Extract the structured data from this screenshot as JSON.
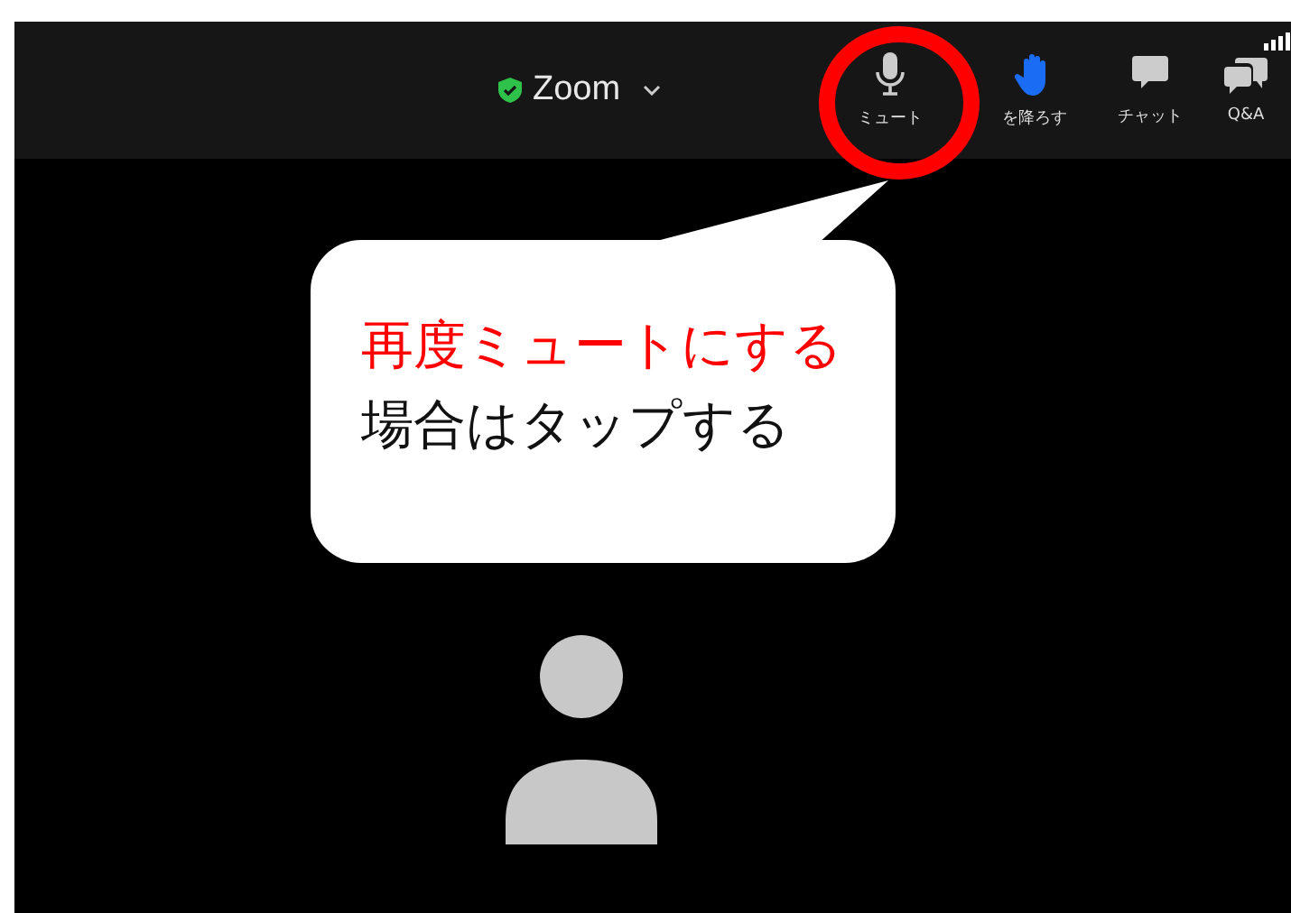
{
  "meeting_bar": {
    "title": "Zoom",
    "buttons": [
      {
        "kind": "mic",
        "label": "ミュート"
      },
      {
        "kind": "hand",
        "label": "を降ろす"
      },
      {
        "kind": "chat",
        "label": "チャット"
      },
      {
        "kind": "qa",
        "label": "Q&A"
      }
    ]
  },
  "callout": {
    "lines": [
      {
        "kind": "highlight",
        "text": "再度ミュートにする"
      },
      {
        "kind": "plain",
        "text": "場合はタップする"
      }
    ]
  }
}
